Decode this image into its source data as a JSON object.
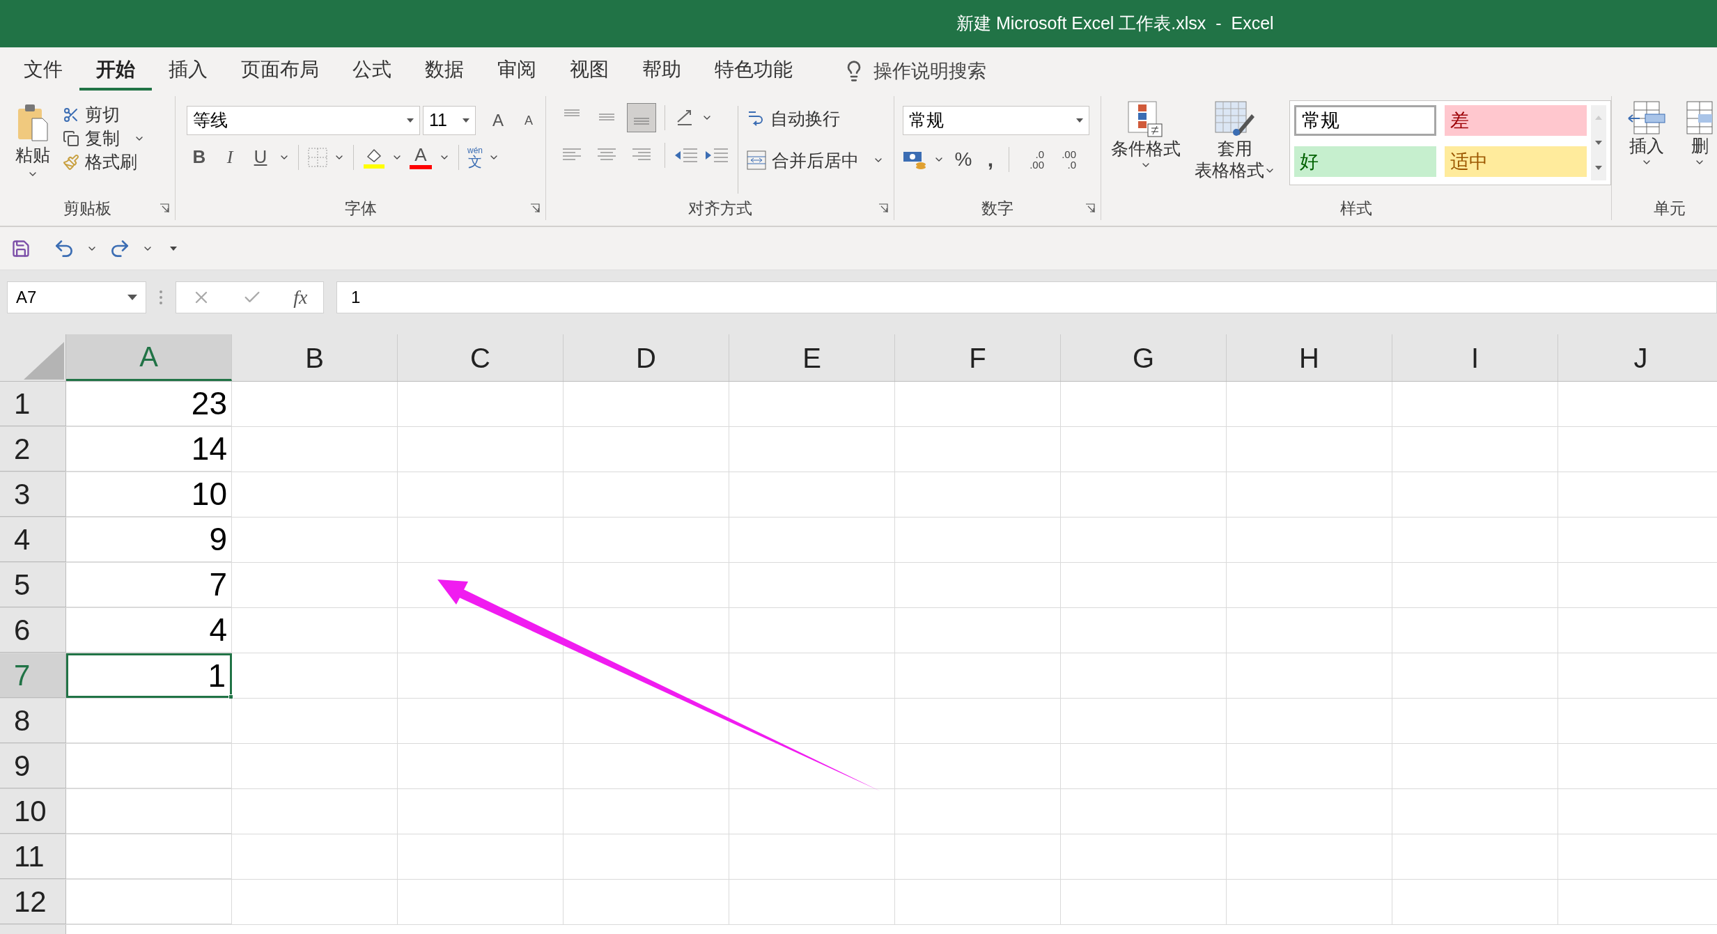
{
  "window": {
    "title": "新建 Microsoft Excel 工作表.xlsx  -  Excel"
  },
  "tabs": [
    {
      "label": "文件",
      "selected": false
    },
    {
      "label": "开始",
      "selected": true
    },
    {
      "label": "插入",
      "selected": false
    },
    {
      "label": "页面布局",
      "selected": false
    },
    {
      "label": "公式",
      "selected": false
    },
    {
      "label": "数据",
      "selected": false
    },
    {
      "label": "审阅",
      "selected": false
    },
    {
      "label": "视图",
      "selected": false
    },
    {
      "label": "帮助",
      "selected": false
    },
    {
      "label": "特色功能",
      "selected": false
    }
  ],
  "tell_me": {
    "placeholder": "操作说明搜索"
  },
  "clipboard": {
    "paste": "粘贴",
    "cut": "剪切",
    "copy": "复制",
    "painter": "格式刷",
    "label": "剪贴板"
  },
  "font": {
    "name": "等线",
    "size": "11",
    "grow": "A",
    "shrink": "A",
    "bold": "B",
    "italic": "I",
    "underline": "U",
    "font_color": "A",
    "phonetic_top": "wén",
    "phonetic": "文",
    "label": "字体"
  },
  "alignment": {
    "vertical_align": [
      {
        "selected": false
      },
      {
        "selected": false
      },
      {
        "selected": true
      }
    ],
    "wrap": "自动换行",
    "merge": "合并后居中",
    "label": "对齐方式"
  },
  "number": {
    "format": "常规",
    "percent": "%",
    "comma": ",",
    "decimals": [
      {
        "top": ".0",
        "bottom": ".00"
      },
      {
        "top": ".00",
        "bottom": ".0"
      }
    ],
    "label": "数字"
  },
  "styles": {
    "conditional": "条件格式",
    "table_1": "套用",
    "table_2": "表格格式",
    "gallery": [
      {
        "label": "常规",
        "kind": "normal"
      },
      {
        "label": "差",
        "kind": "bad"
      },
      {
        "label": "好",
        "kind": "good"
      },
      {
        "label": "适中",
        "kind": "neutral"
      }
    ],
    "label": "样式"
  },
  "cells": {
    "insert": "插入",
    "delete": "删",
    "label": "单元"
  },
  "formula_bar": {
    "name_box": "A7",
    "fx": "fx",
    "value": "1"
  },
  "sheet": {
    "columns": [
      {
        "label": "A",
        "selected": true
      },
      {
        "label": "B",
        "selected": false
      },
      {
        "label": "C",
        "selected": false
      },
      {
        "label": "D",
        "selected": false
      },
      {
        "label": "E",
        "selected": false
      },
      {
        "label": "F",
        "selected": false
      },
      {
        "label": "G",
        "selected": false
      },
      {
        "label": "H",
        "selected": false
      },
      {
        "label": "I",
        "selected": false
      },
      {
        "label": "J",
        "selected": false
      }
    ],
    "rows": [
      {
        "label": "1",
        "selected": false,
        "a": "23"
      },
      {
        "label": "2",
        "selected": false,
        "a": "14"
      },
      {
        "label": "3",
        "selected": false,
        "a": "10"
      },
      {
        "label": "4",
        "selected": false,
        "a": "9"
      },
      {
        "label": "5",
        "selected": false,
        "a": "7"
      },
      {
        "label": "6",
        "selected": false,
        "a": "4"
      },
      {
        "label": "7",
        "selected": true,
        "a": "1"
      },
      {
        "label": "8",
        "selected": false
      },
      {
        "label": "9",
        "selected": false
      },
      {
        "label": "10",
        "selected": false
      },
      {
        "label": "11",
        "selected": false
      },
      {
        "label": "12",
        "selected": false
      }
    ]
  }
}
